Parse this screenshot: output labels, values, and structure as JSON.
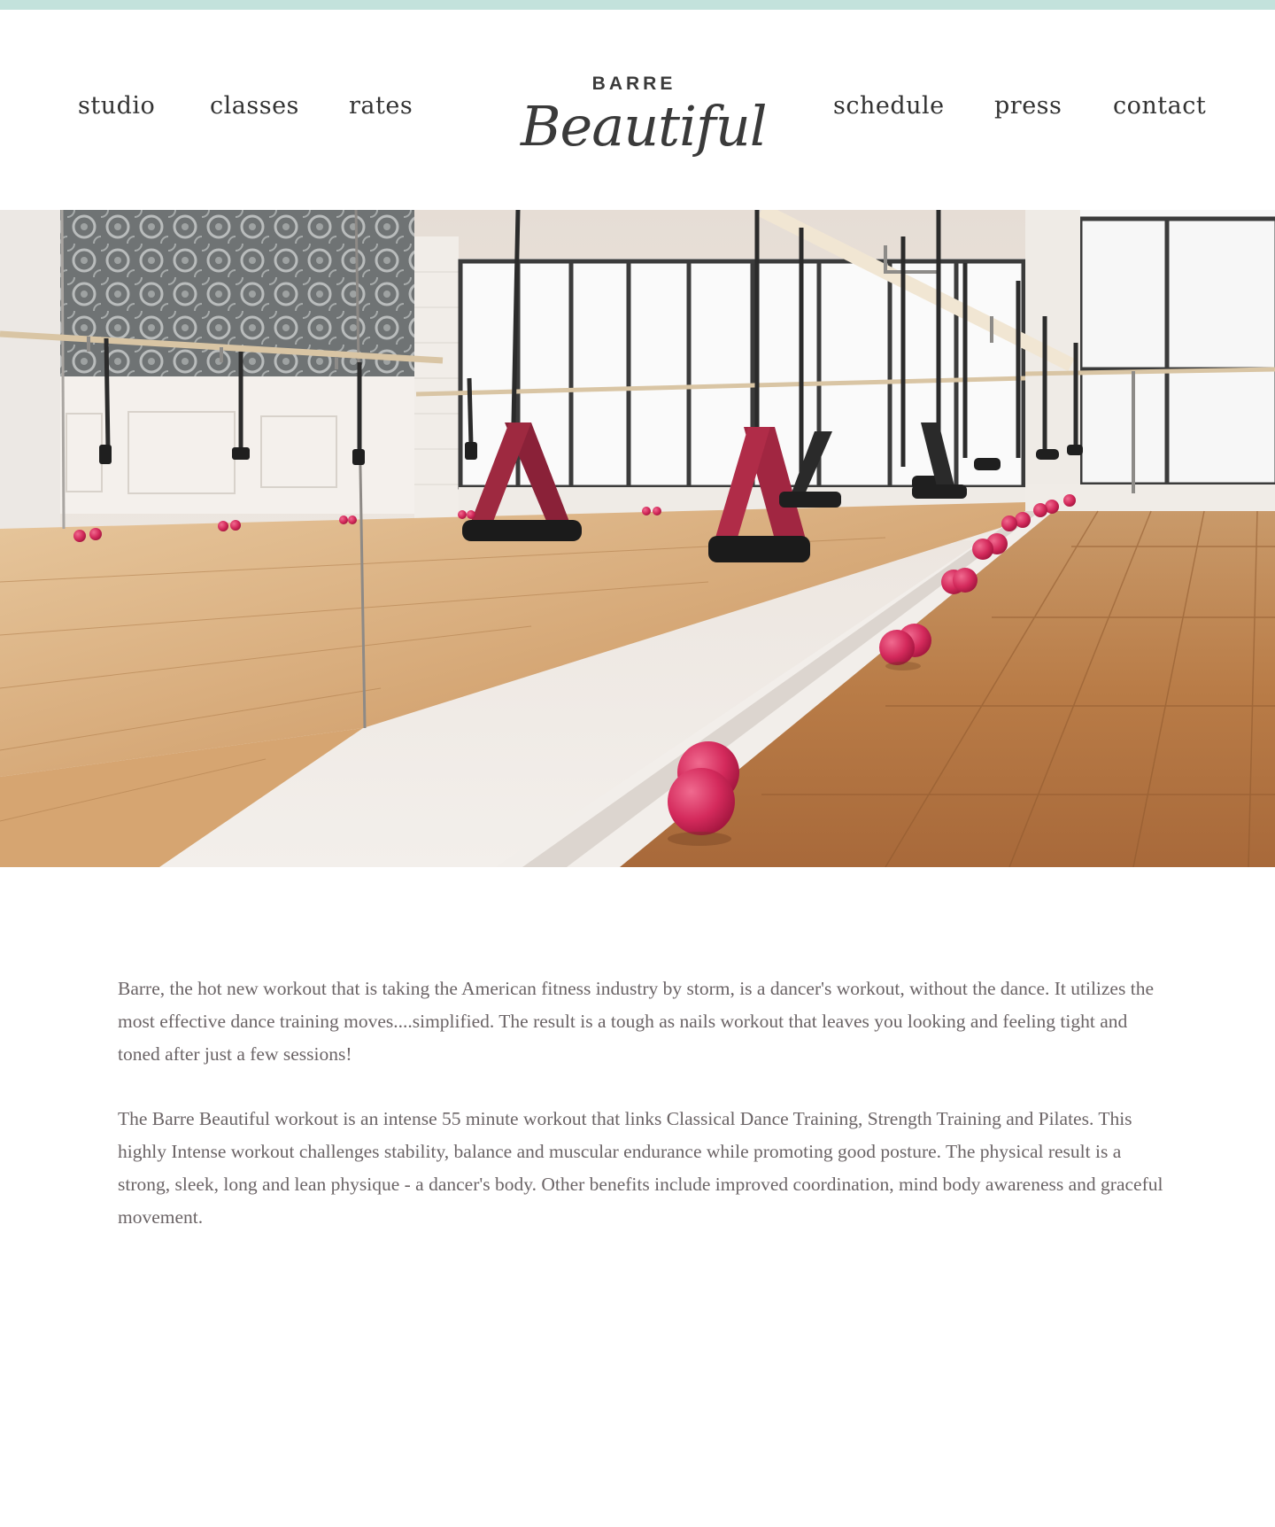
{
  "nav": {
    "left": [
      "studio",
      "classes",
      "rates"
    ],
    "right": [
      "schedule",
      "press",
      "contact"
    ]
  },
  "logo": {
    "top": "BARRE",
    "script": "Beautiful"
  },
  "hero": {
    "alt": "Barre studio with mirrors, ballet barres, resistance bands and pink balls"
  },
  "content": {
    "paragraphs": [
      "Barre, the hot new workout that is taking the American fitness industry by storm, is a dancer's workout, without the dance. It utilizes the most effective dance training moves....simplified. The result is a tough as nails workout that leaves you looking and feeling tight and toned after just a few sessions!",
      "The Barre Beautiful workout is an intense 55 minute workout that links Classical Dance Training, Strength Training and Pilates. This highly Intense workout challenges stability, balance and muscular endurance while promoting good posture. The physical result is a strong, sleek, long and lean physique - a  dancer's body. Other benefits include improved coordination, mind body awareness and graceful movement."
    ]
  },
  "colors": {
    "top_bar": "#c3e2dc",
    "text_body": "#6b6466",
    "text_nav": "#333333",
    "ball": "#d42a5c"
  }
}
